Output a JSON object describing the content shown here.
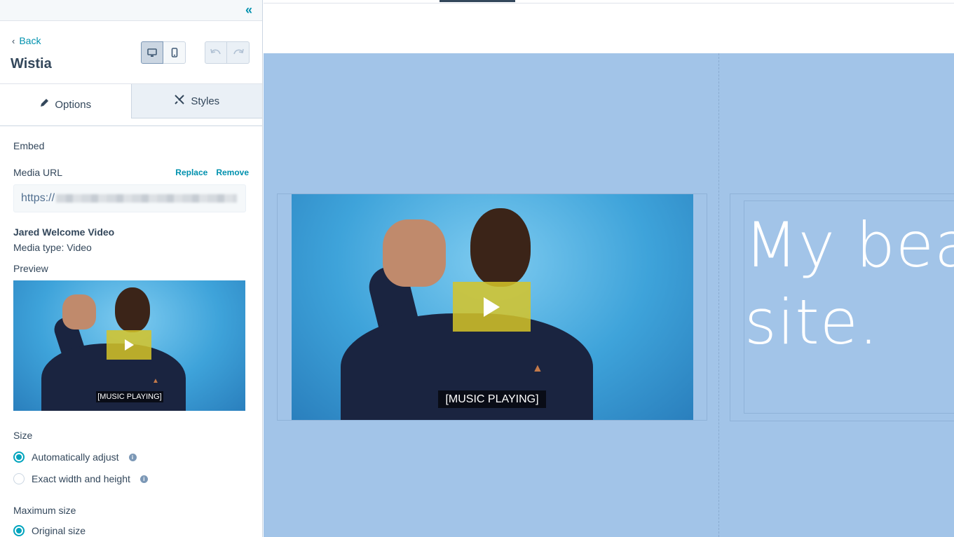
{
  "sidebar": {
    "collapse_icon": "double-chevron-left-icon",
    "back_label": "Back",
    "module_title": "Wistia",
    "tabs": [
      {
        "label": "Options",
        "icon": "pencil-icon",
        "active": true
      },
      {
        "label": "Styles",
        "icon": "brush-icon",
        "active": false
      }
    ],
    "embed_label": "Embed",
    "media_url_label": "Media URL",
    "replace_label": "Replace",
    "remove_label": "Remove",
    "media_url_value": "https://",
    "video_name": "Jared Welcome Video",
    "media_type": "Media type:  Video",
    "preview_label": "Preview",
    "size_label": "Size",
    "size_options": [
      {
        "label": "Automatically adjust",
        "checked": true
      },
      {
        "label": "Exact width and height",
        "checked": false
      }
    ],
    "max_size_label": "Maximum size",
    "max_size_option": "Original size"
  },
  "video": {
    "caption": "[MUSIC PLAYING]"
  },
  "canvas": {
    "hero_line1": "My bea",
    "hero_line2": "site."
  },
  "colors": {
    "accent": "#0091ae",
    "radio": "#00a4bd",
    "section_bg": "#a2c4e8",
    "play_button": "#d6c428"
  }
}
